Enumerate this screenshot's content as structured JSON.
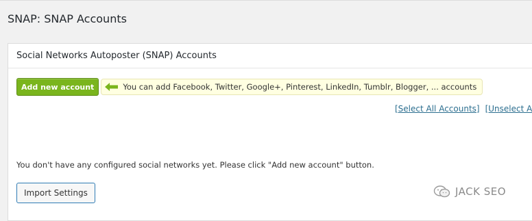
{
  "page": {
    "title": "SNAP: SNAP Accounts"
  },
  "panel": {
    "header": "Social Networks Autoposter (SNAP) Accounts",
    "add_button": "Add new account",
    "hint_text": "You can add Facebook, Twitter, Google+, Pinterest, LinkedIn, Tumblr, Blogger, ... accounts",
    "select_all": "[Select All Accounts]",
    "unselect_all": "[Unselect All A",
    "empty_message": "You don't have any configured social networks yet. Please click \"Add new account\" button.",
    "import_button": "Import Settings"
  },
  "watermark": {
    "text": "JACK SEO",
    "icon": "wechat-icon"
  },
  "colors": {
    "add_button": "#7ab51d",
    "hint_background": "#ffffe1",
    "link": "#2b6e8f",
    "import_border": "#2e7bb4"
  }
}
